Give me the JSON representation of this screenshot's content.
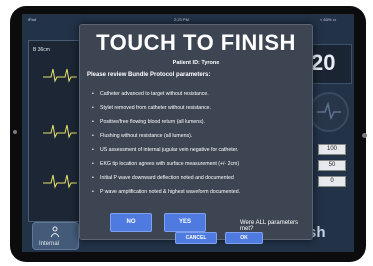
{
  "status_bar": {
    "carrier": "iPad",
    "time": "2:23 PM",
    "battery": "< 63% ▭"
  },
  "background": {
    "monitor_value": "20",
    "left_label": "B 36cm",
    "inputs": [
      "100",
      "50",
      "0"
    ],
    "bottom_button_label": "Internal",
    "partial_text": "sh"
  },
  "modal": {
    "title": "TOUCH TO FINISH",
    "patient": "Patient ID: Tyrone",
    "prompt": "Please review Bundle Protocol parameters:",
    "items": [
      "Catheter advanced to target without resistance.",
      "Stylet removed from catheter without resistance.",
      "Positive/free flowing blood return (all lumens).",
      "Flushing without resistance (all lumens).",
      "US assessment of internal jugular vein negative for catheter.",
      "EKG tip location agrees with surface measurement (+/- 2cm)",
      "Initial P wave downward deflection noted and documented",
      "P wave amplification noted & highest waveform documented."
    ],
    "bullet": "•",
    "no_label": "NO",
    "yes_label": "YES",
    "question": "Were ALL parameters met?",
    "cancel_label": "CANCEL",
    "ok_label": "OK"
  }
}
